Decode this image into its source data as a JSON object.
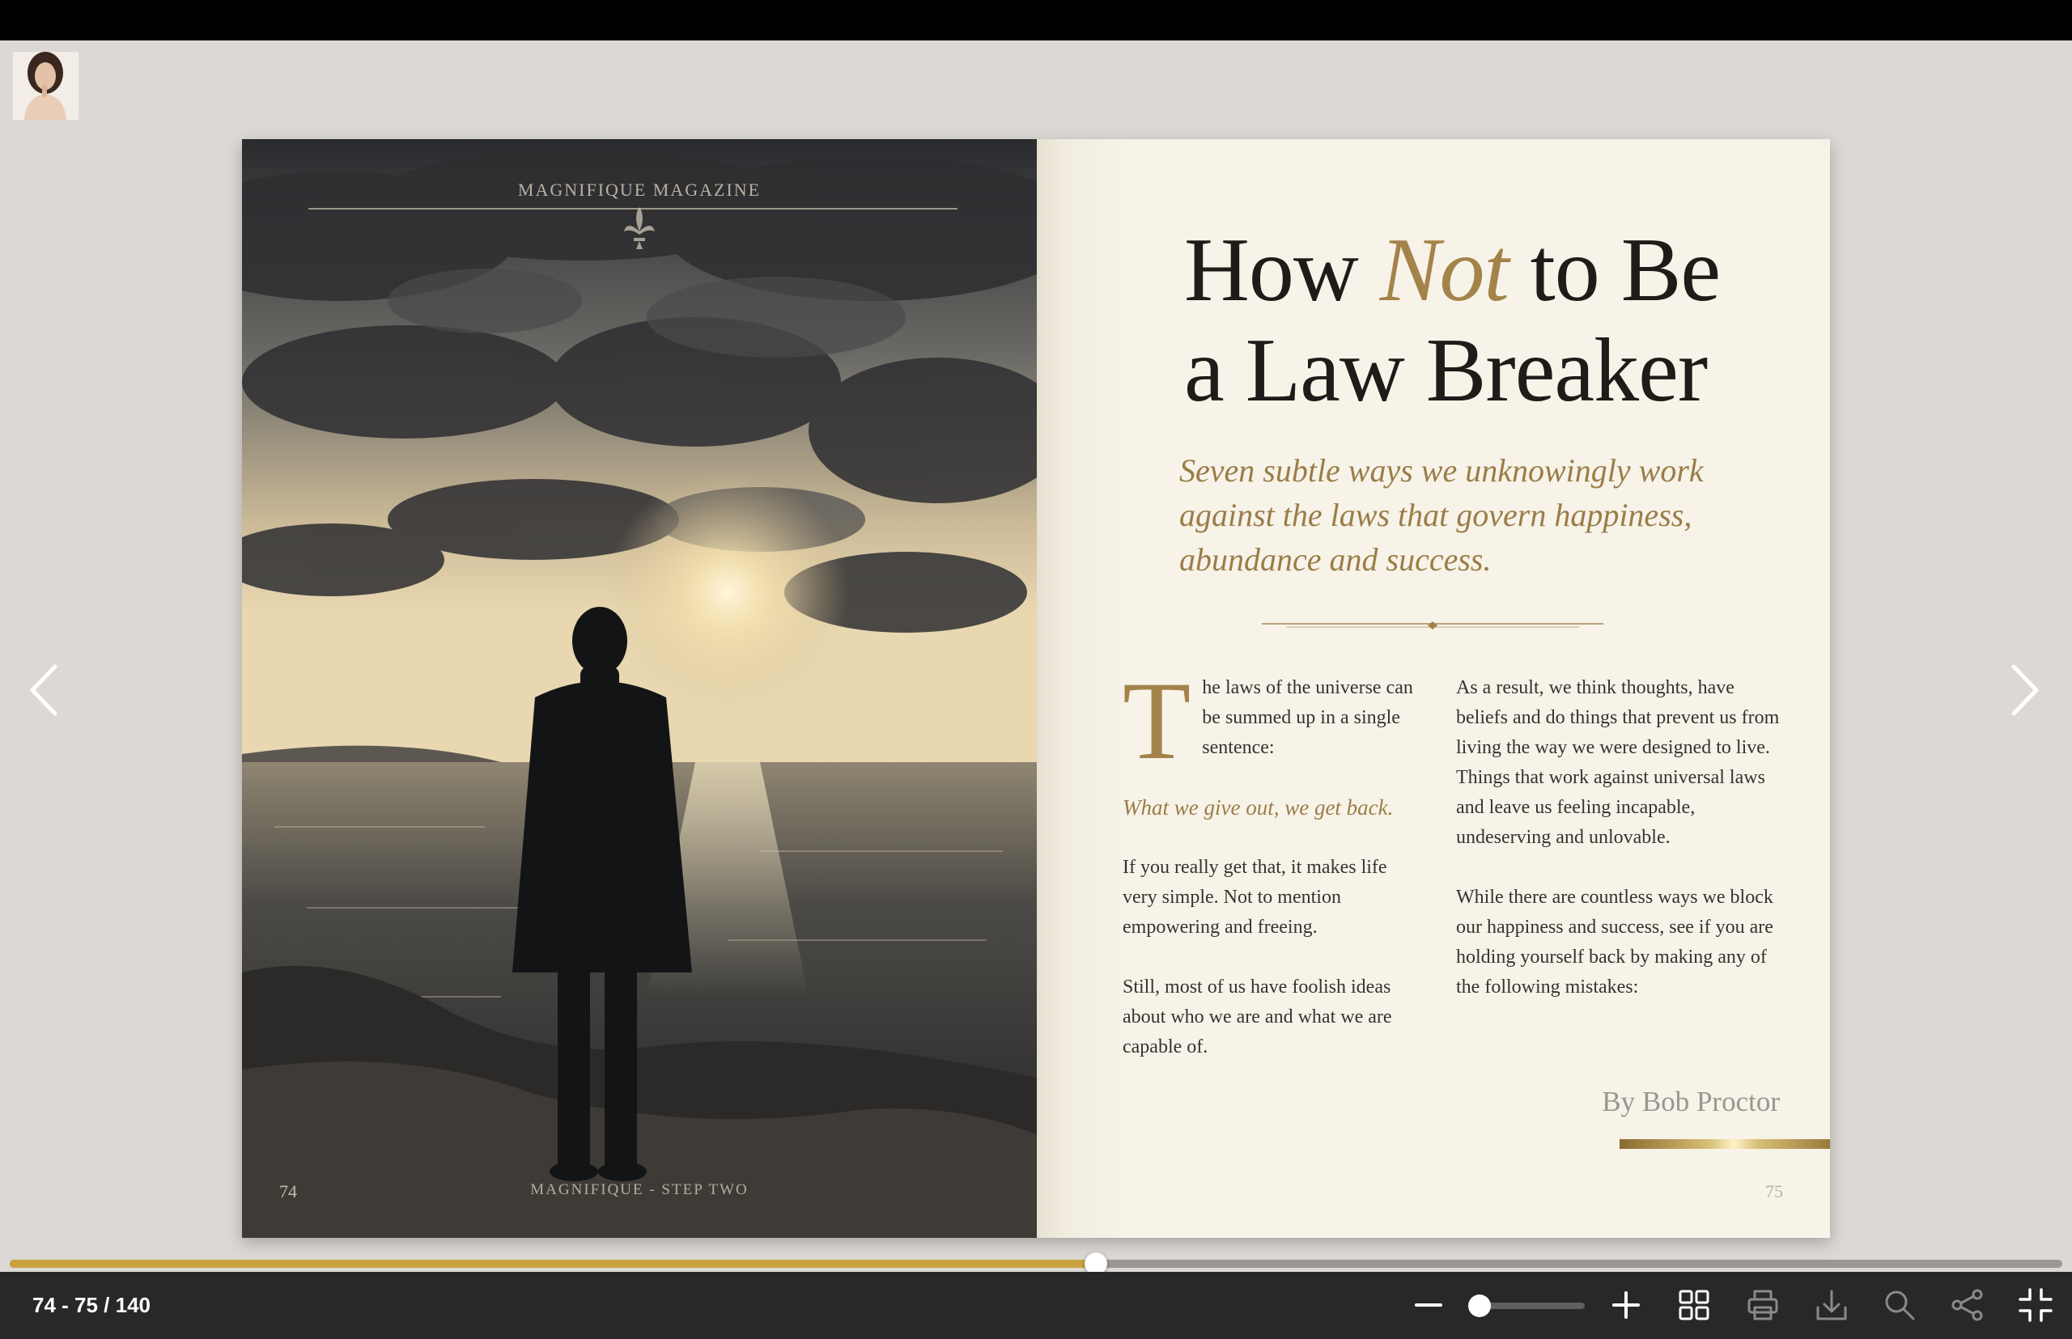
{
  "viewer": {
    "page_indicator": "74 - 75 / 140",
    "progress_fraction": 0.529,
    "zoom_fraction": 0.0,
    "accent_color": "#c8a33e"
  },
  "left_page": {
    "masthead": "MAGNIFIQUE MAGAZINE",
    "page_number": "74",
    "footer": "MAGNIFIQUE - STEP TWO"
  },
  "right_page": {
    "title_line1_a": "How ",
    "title_line1_accent": "Not",
    "title_line1_b": " to Be",
    "title_line2": "a Law Breaker",
    "subtitle": "Seven subtle ways we unknowingly work against the laws that govern happiness, abundance and success.",
    "col1": {
      "dropcap": "T",
      "p1": "he laws of the universe can be summed up in a single sentence:",
      "quote": "What we give out, we get back.",
      "p2": "If you really get that, it makes life very simple. Not to mention empowering and freeing.",
      "p3": "Still, most of us have foolish ideas about who we are and what we are capable of."
    },
    "col2": {
      "p1": "As a result, we think thoughts, have beliefs and do things that prevent us from living the way we were designed to live. Things that work against universal laws and leave us feeling incapable, undeserving and unlovable.",
      "p2": "While there are countless ways we block our happiness and success, see if you are holding yourself back by making any of the following mistakes:"
    },
    "byline": "By Bob Proctor",
    "page_number": "75"
  },
  "icons": {
    "prev": "chevron-left-icon",
    "next": "chevron-right-icon",
    "zoom_out": "minus-icon",
    "zoom_in": "plus-icon",
    "thumbnails": "grid-icon",
    "print": "printer-icon",
    "download": "download-icon",
    "search": "search-icon",
    "share": "share-icon",
    "exit_fullscreen": "compress-icon"
  }
}
